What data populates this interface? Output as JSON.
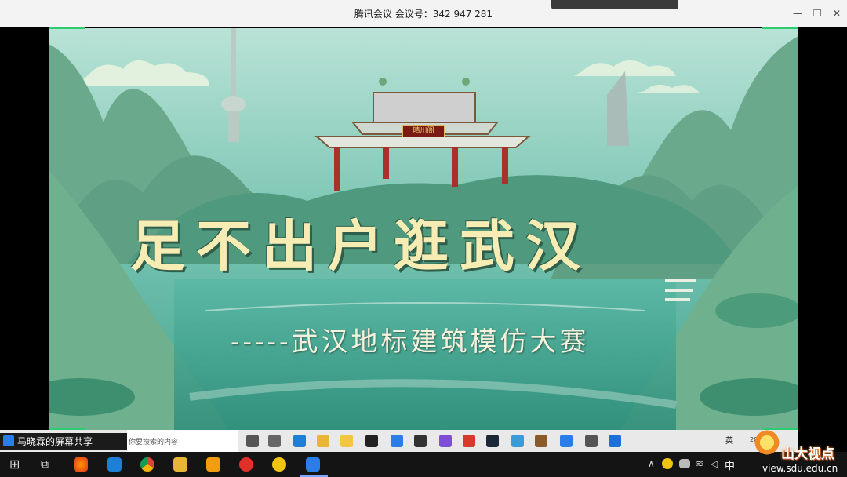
{
  "window": {
    "title": "腾讯会议 会议号：342 947 281",
    "minimize_glyph": "—",
    "restore_glyph": "❐",
    "close_glyph": "✕"
  },
  "slide": {
    "gate_sign": "晴川阁",
    "main_title": "足不出户逛武汉",
    "subtitle": "-----武汉地标建筑模仿大赛"
  },
  "share_bar": {
    "label": "马晓霖的屏幕共享",
    "search_placeholder": "你要搜索的内容",
    "ime_label": "英",
    "clock_partial": "2020"
  },
  "taskbar": {
    "ime_label": "中",
    "show_hidden_glyph": "∧"
  },
  "watermark": {
    "name": "山大视点",
    "url": "view.sdu.edu.cn"
  },
  "colors": {
    "title_cream": "#f6ecb4",
    "share_border": "#2ecc71",
    "taskbar": "#141414"
  }
}
